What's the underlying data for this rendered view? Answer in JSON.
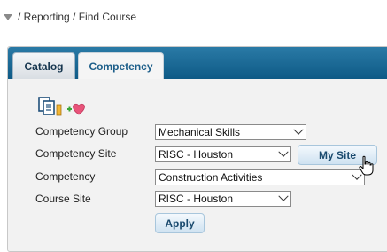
{
  "breadcrumb": "/ Reporting / Find Course",
  "tabs": {
    "catalog": "Catalog",
    "competency": "Competency"
  },
  "form": {
    "competency_group": {
      "label": "Competency Group",
      "value": "Mechanical Skills"
    },
    "competency_site": {
      "label": "Competency Site",
      "value": "RISC - Houston"
    },
    "competency": {
      "label": "Competency",
      "value": "Construction Activities"
    },
    "course_site": {
      "label": "Course Site",
      "value": "RISC - Houston"
    }
  },
  "buttons": {
    "my_site": "My Site",
    "apply": "Apply"
  },
  "colors": {
    "tab_bar": "#0e5a86",
    "tab_text": "#1e5f8a",
    "button_text": "#1a4a6e",
    "heart": "#e8547a",
    "plus": "#3aa63a"
  },
  "icons": {
    "copy": "copy-documents-icon",
    "favorite": "add-favorite-heart-icon",
    "cursor": "hand-pointer-icon",
    "breadcrumb_toggle": "collapse-triangle-icon"
  }
}
